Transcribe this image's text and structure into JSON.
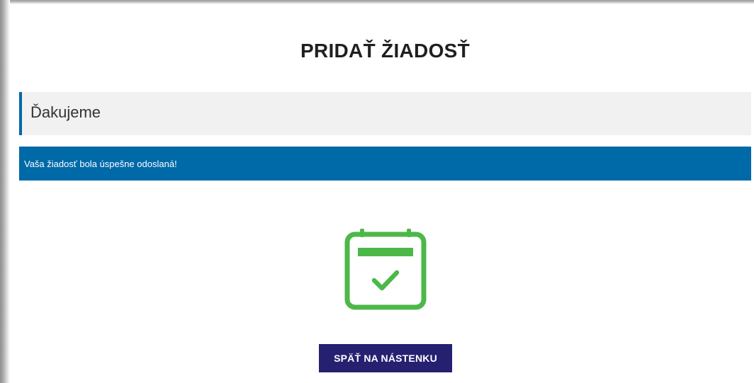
{
  "page": {
    "title": "PRIDAŤ ŽIADOSŤ"
  },
  "thanks_panel": {
    "heading": "Ďakujeme"
  },
  "success_message": {
    "text": "Vaša žiadosť bola úspešne odoslaná!"
  },
  "success_icon": {
    "name": "calendar-check-icon",
    "color": "#4cb848"
  },
  "actions": {
    "back_label": "SPÄŤ NA NÁSTENKU"
  },
  "colors": {
    "accent": "#0069a8",
    "button": "#252070",
    "panel": "#f1f1f1"
  }
}
